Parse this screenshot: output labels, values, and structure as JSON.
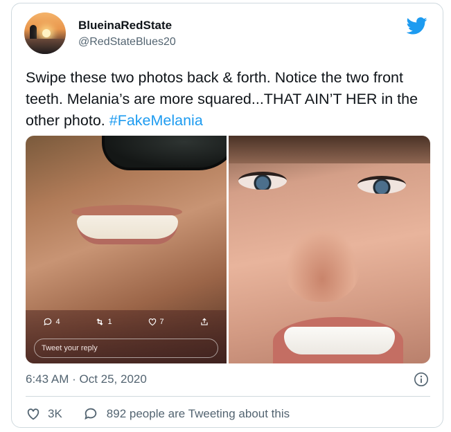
{
  "user": {
    "display_name": "BlueinaRedState",
    "handle": "@RedStateBlues20"
  },
  "tweet": {
    "text": "Swipe these two photos back & forth. Notice the two front teeth. Melania’s are more squared...THAT AIN’T HER in the other photo. ",
    "hashtag": "#FakeMelania",
    "timestamp": "6:43 AM · Oct 25, 2020",
    "likes": "3K",
    "conversation": "892 people are Tweeting about this"
  },
  "embedded_overlay": {
    "reply_count": "4",
    "retweet_count": "1",
    "like_count": "7",
    "reply_placeholder": "Tweet your reply"
  },
  "icons": {
    "brand": "twitter-bird-icon",
    "info": "info-icon",
    "like": "heart-icon",
    "reply": "speech-bubble-icon",
    "retweet": "retweet-icon",
    "share": "share-icon"
  },
  "colors": {
    "brand_blue": "#1d9bf0",
    "text_primary": "#0f1419",
    "text_secondary": "#536471",
    "border": "#cfd9de"
  }
}
